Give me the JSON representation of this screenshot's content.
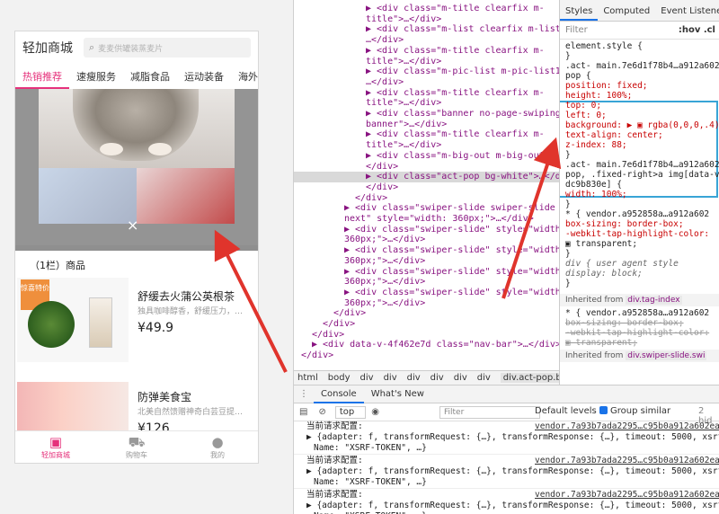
{
  "mobile": {
    "logo": "轻加商城",
    "search_placeholder": "麦麦供罐装蒸麦片",
    "nav_tabs": [
      "热销推荐",
      "速瘦服务",
      "减脂食品",
      "运动装备",
      "海外"
    ],
    "section_title": "（1栏）商品",
    "products": [
      {
        "name": "舒缓去火蒲公英根茶",
        "desc": "独具咖啡醇香，舒缓压力，…",
        "price": "¥49.9",
        "tag": "惊喜特价"
      },
      {
        "name": "防弹美食宝",
        "desc": "北美自然馈赠神奇白芸豆提…",
        "price": "¥126"
      }
    ],
    "tabbar": [
      {
        "label": "轻加商城",
        "icon": "shop-bag-icon"
      },
      {
        "label": "购物车",
        "icon": "cart-icon"
      },
      {
        "label": "我的",
        "icon": "user-icon"
      }
    ],
    "close_glyph": "×"
  },
  "elements": {
    "lines": [
      {
        "indent": 6,
        "text": "▶ <div class=\"m-title clearfix m-"
      },
      {
        "indent": 6,
        "text": "title\">…</div>"
      },
      {
        "indent": 6,
        "text": "▶ <div class=\"m-list clearfix m-list6\">"
      },
      {
        "indent": 6,
        "text": "…</div>"
      },
      {
        "indent": 6,
        "text": "▶ <div class=\"m-title clearfix m-"
      },
      {
        "indent": 6,
        "text": "title\">…</div>"
      },
      {
        "indent": 6,
        "text": "▶ <div class=\"m-pic-list m-pic-list1\">"
      },
      {
        "indent": 6,
        "text": "…</div>"
      },
      {
        "indent": 6,
        "text": "▶ <div class=\"m-title clearfix m-"
      },
      {
        "indent": 6,
        "text": "title\">…</div>"
      },
      {
        "indent": 6,
        "text": "▶ <div class=\"banner no-page-swiping"
      },
      {
        "indent": 6,
        "text": "banner\">…</div>"
      },
      {
        "indent": 6,
        "text": "▶ <div class=\"m-title clearfix m-"
      },
      {
        "indent": 6,
        "text": "title\">…</div>"
      },
      {
        "indent": 6,
        "text": "▶ <div class=\"m-big-out m-big-out\">…"
      },
      {
        "indent": 6,
        "text": "</div>"
      },
      {
        "indent": 6,
        "text": "▶ <div class=\"act-pop bg-white\">…</div> == $0"
      },
      {
        "indent": 6,
        "text": "</div>"
      },
      {
        "indent": 5,
        "text": "</div>"
      },
      {
        "indent": 4,
        "text": "▶ <div class=\"swiper-slide swiper-slide"
      },
      {
        "indent": 4,
        "text": "next\" style=\"width: 360px;\">…</div>"
      },
      {
        "indent": 4,
        "text": "▶ <div class=\"swiper-slide\" style=\"width:"
      },
      {
        "indent": 4,
        "text": "360px;\">…</div>"
      },
      {
        "indent": 4,
        "text": "▶ <div class=\"swiper-slide\" style=\"width:"
      },
      {
        "indent": 4,
        "text": "360px;\">…</div>"
      },
      {
        "indent": 4,
        "text": "▶ <div class=\"swiper-slide\" style=\"width:"
      },
      {
        "indent": 4,
        "text": "360px;\">…</div>"
      },
      {
        "indent": 4,
        "text": "▶ <div class=\"swiper-slide\" style=\"width:"
      },
      {
        "indent": 4,
        "text": "360px;\">…</div>"
      },
      {
        "indent": 3,
        "text": "</div>"
      },
      {
        "indent": 2,
        "text": "</div>"
      },
      {
        "indent": 1,
        "text": "</div>"
      },
      {
        "indent": 1,
        "text": "▶ <div data-v-4f462e7d class=\"nav-bar\">…</div>"
      },
      {
        "indent": 0,
        "text": "</div>"
      }
    ],
    "selected_index": 16
  },
  "breadcrumb": [
    "html",
    "body",
    "div",
    "div",
    "div",
    "div",
    "div",
    "div",
    "div.act-pop.bg-white"
  ],
  "styles": {
    "tabs": [
      "Styles",
      "Computed",
      "Event Listeners"
    ],
    "filter_placeholder": "Filter",
    "hov": ":hov .cl",
    "lines": [
      {
        "t": "element.style {",
        "c": "norm"
      },
      {
        "t": "}",
        "c": "norm"
      },
      {
        "t": ".act-      main.7e6d1f78b4…a912a602",
        "c": "norm"
      },
      {
        "t": "pop {",
        "c": "norm"
      },
      {
        "t": "  position: fixed;",
        "c": "prop"
      },
      {
        "t": "  height: 100%;",
        "c": "prop"
      },
      {
        "t": "  top: 0;",
        "c": "prop"
      },
      {
        "t": "  left: 0;",
        "c": "prop"
      },
      {
        "t": "  background: ▶ ▣ rgba(0,0,0,.4);",
        "c": "prop"
      },
      {
        "t": "  text-align: center;",
        "c": "prop"
      },
      {
        "t": "  z-index: 88;",
        "c": "prop"
      },
      {
        "t": "}",
        "c": "norm"
      },
      {
        "t": ".act-      main.7e6d1f78b4…a912a602",
        "c": "norm"
      },
      {
        "t": "pop, .fixed-right>a img[data-v-",
        "c": "norm"
      },
      {
        "t": "dc9b830e] {",
        "c": "norm"
      },
      {
        "t": "  width: 100%;",
        "c": "prop"
      },
      {
        "t": "}",
        "c": "norm"
      },
      {
        "t": "* {        vendor.a952858a…a912a602",
        "c": "norm"
      },
      {
        "t": "  box-sizing: border-box;",
        "c": "prop"
      },
      {
        "t": "  -webkit-tap-highlight-color:",
        "c": "prop"
      },
      {
        "t": "      ▣ transparent;",
        "c": "norm"
      },
      {
        "t": "}",
        "c": "norm"
      },
      {
        "t": "div {          user agent style",
        "c": "ua"
      },
      {
        "t": "  display: block;",
        "c": "ua"
      },
      {
        "t": "}",
        "c": "norm"
      }
    ],
    "inherited_label": "Inherited from",
    "inherited_tag": "div.tag-index",
    "inherited_lines": [
      {
        "t": "* {        vendor.a952858a…a912a602",
        "c": "norm"
      },
      {
        "t": "  box-sizing: border-box;",
        "c": "strike"
      },
      {
        "t": "  -webkit-tap-highlight-color:",
        "c": "strike"
      },
      {
        "t": "      ▣ transparent;",
        "c": "strike"
      }
    ],
    "inherited_label2": "Inherited from",
    "inherited_tag2": "div.swiper-slide.swi"
  },
  "console": {
    "tabs": [
      "Console",
      "What's New"
    ],
    "context": "top",
    "filter_placeholder": "Filter",
    "levels": "Default levels ▾",
    "group_similar": "Group similar",
    "hidden": "2 hid",
    "entries": [
      {
        "msg": "当前请求配置:",
        "src": "vendor.7a93b7ada2295…c95b0a912a602ea3"
      },
      {
        "obj": "{adapter: f, transformRequest: {…}, transformResponse: {…}, timeout: 5000, xsrfCoo"
      },
      {
        "obj2": "Name: \"XSRF-TOKEN\", …}"
      }
    ]
  },
  "colors": {
    "accent": "#e5317b",
    "highlight": "#38a4d6",
    "arrow": "#e0342c"
  }
}
